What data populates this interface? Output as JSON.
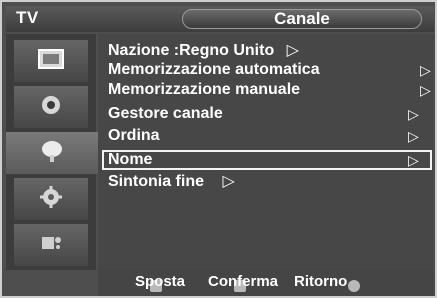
{
  "header": {
    "left_label": "TV",
    "title": "Canale"
  },
  "sidebar": {
    "icons": [
      {
        "name": "picture-icon",
        "active": false
      },
      {
        "name": "sound-icon",
        "active": false
      },
      {
        "name": "channel-icon",
        "active": true
      },
      {
        "name": "setup-icon",
        "active": false
      },
      {
        "name": "input-icon",
        "active": false
      }
    ]
  },
  "menu": {
    "items": [
      {
        "label": "Nazione :Regno Unito",
        "arrow": "▷"
      },
      {
        "label": "Memorizzazione automatica",
        "arrow": "▷"
      },
      {
        "label": "Memorizzazione manuale",
        "arrow": "▷"
      },
      {
        "label": "Gestore canale",
        "arrow": "▷"
      },
      {
        "label": "Ordina",
        "arrow": "▷"
      },
      {
        "label": "Nome",
        "arrow": "▷"
      },
      {
        "label": "Sintonia fine",
        "arrow": "▷"
      }
    ],
    "selected_index": 5
  },
  "footer": {
    "move_label": "Sposta",
    "confirm_label": "Conferma",
    "return_label": "Ritorno"
  }
}
